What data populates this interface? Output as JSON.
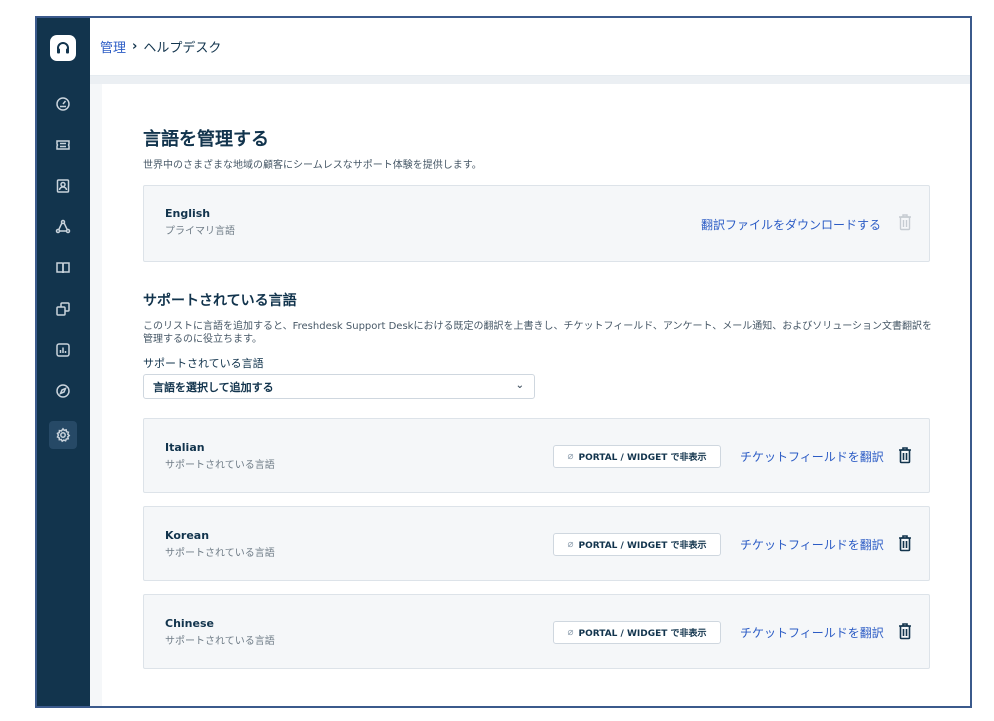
{
  "breadcrumb": {
    "parent": "管理",
    "separator": "›",
    "current": "ヘルプデスク"
  },
  "sidebar": {
    "items": [
      {
        "icon": "dashboard-icon"
      },
      {
        "icon": "ticket-icon"
      },
      {
        "icon": "contacts-icon"
      },
      {
        "icon": "social-icon"
      },
      {
        "icon": "book-icon"
      },
      {
        "icon": "copy-icon"
      },
      {
        "icon": "reports-icon"
      },
      {
        "icon": "compass-icon"
      },
      {
        "icon": "settings-icon",
        "active": true
      }
    ]
  },
  "page": {
    "title": "言語を管理する",
    "description": "世界中のさまざまな地域の顧客にシームレスなサポート体験を提供します。"
  },
  "primary_language": {
    "name": "English",
    "subtitle": "プライマリ言語",
    "download_label": "翻訳ファイルをダウンロードする"
  },
  "supported": {
    "title": "サポートされている言語",
    "description": "このリストに言語を追加すると、Freshdesk Support Deskにおける既定の翻訳を上書きし、チケットフィールド、アンケート、メール通知、およびソリューション文書翻訳を管理するのに役立ちます。",
    "field_label": "サポートされている言語",
    "select_value": "言語を選択して追加する",
    "hide_label": "PORTAL / WIDGET で非表示",
    "translate_label": "チケットフィールドを翻訳",
    "languages": [
      {
        "name": "Italian",
        "subtitle": "サポートされている言語"
      },
      {
        "name": "Korean",
        "subtitle": "サポートされている言語"
      },
      {
        "name": "Chinese",
        "subtitle": "サポートされている言語"
      }
    ]
  },
  "colors": {
    "sidebar": "#12344d",
    "link": "#2c5cc5",
    "card_bg": "#f5f7f9"
  }
}
